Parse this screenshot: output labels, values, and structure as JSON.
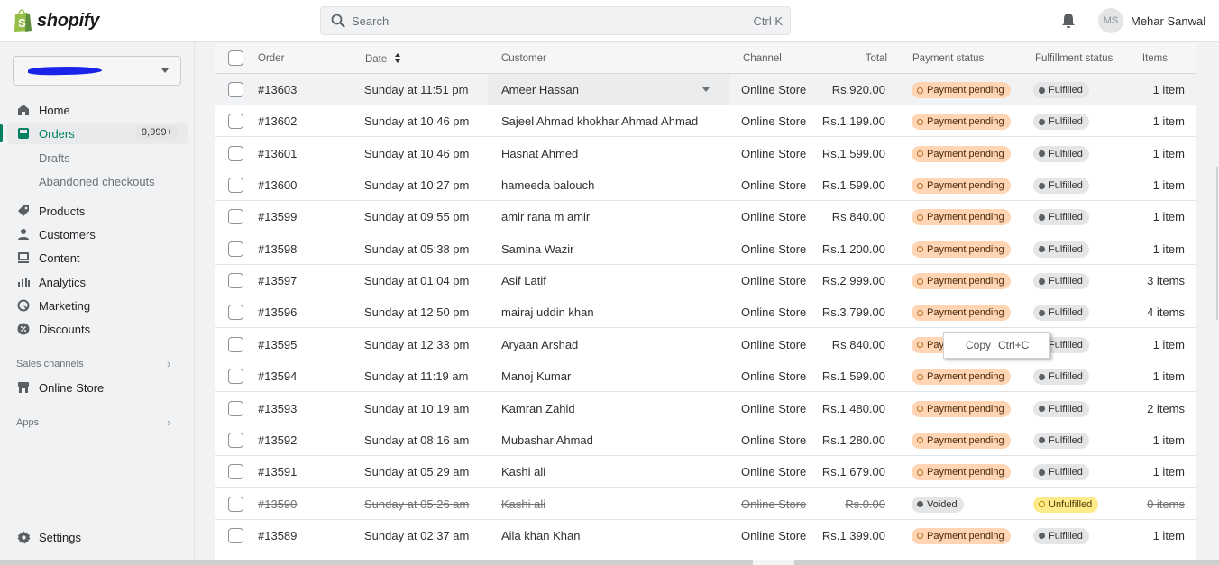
{
  "app": {
    "brand": "shopify",
    "search_placeholder": "Search",
    "search_shortcut": "Ctrl K",
    "user_initials": "MS",
    "user_name": "Mehar Sanwal"
  },
  "sidebar": {
    "store_name": "(redacted)",
    "items": [
      {
        "label": "Home",
        "icon": "home-icon"
      },
      {
        "label": "Orders",
        "icon": "orders-icon",
        "badge": "9,999+",
        "active": true
      },
      {
        "label": "Products",
        "icon": "tag-icon"
      },
      {
        "label": "Customers",
        "icon": "person-icon"
      },
      {
        "label": "Content",
        "icon": "content-icon"
      },
      {
        "label": "Analytics",
        "icon": "analytics-icon"
      },
      {
        "label": "Marketing",
        "icon": "marketing-icon"
      },
      {
        "label": "Discounts",
        "icon": "discount-icon"
      }
    ],
    "order_subitems": [
      "Drafts",
      "Abandoned checkouts"
    ],
    "sales_channels_label": "Sales channels",
    "online_store_label": "Online Store",
    "apps_label": "Apps",
    "settings_label": "Settings",
    "accent_color": "#008060"
  },
  "table": {
    "headers": {
      "order": "Order",
      "date": "Date",
      "customer": "Customer",
      "channel": "Channel",
      "total": "Total",
      "payment": "Payment status",
      "fulfillment": "Fulfillment status",
      "items": "Items"
    },
    "rows": [
      {
        "order": "#13603",
        "date": "Sunday at 11:51 pm",
        "customer": "Ameer Hassan",
        "channel": "Online Store",
        "total": "Rs.920.00",
        "payment": "Payment pending",
        "fulfillment": "Fulfilled",
        "items": "1 item"
      },
      {
        "order": "#13602",
        "date": "Sunday at 10:46 pm",
        "customer": "Sajeel Ahmad khokhar Ahmad Ahmad",
        "channel": "Online Store",
        "total": "Rs.1,199.00",
        "payment": "Payment pending",
        "fulfillment": "Fulfilled",
        "items": "1 item"
      },
      {
        "order": "#13601",
        "date": "Sunday at 10:46 pm",
        "customer": "Hasnat Ahmed",
        "channel": "Online Store",
        "total": "Rs.1,599.00",
        "payment": "Payment pending",
        "fulfillment": "Fulfilled",
        "items": "1 item"
      },
      {
        "order": "#13600",
        "date": "Sunday at 10:27 pm",
        "customer": "hameeda balouch",
        "channel": "Online Store",
        "total": "Rs.1,599.00",
        "payment": "Payment pending",
        "fulfillment": "Fulfilled",
        "items": "1 item"
      },
      {
        "order": "#13599",
        "date": "Sunday at 09:55 pm",
        "customer": "amir rana m amir",
        "channel": "Online Store",
        "total": "Rs.840.00",
        "payment": "Payment pending",
        "fulfillment": "Fulfilled",
        "items": "1 item"
      },
      {
        "order": "#13598",
        "date": "Sunday at 05:38 pm",
        "customer": "Samina Wazir",
        "channel": "Online Store",
        "total": "Rs.1,200.00",
        "payment": "Payment pending",
        "fulfillment": "Fulfilled",
        "items": "1 item"
      },
      {
        "order": "#13597",
        "date": "Sunday at 01:04 pm",
        "customer": "Asif Latif",
        "channel": "Online Store",
        "total": "Rs.2,999.00",
        "payment": "Payment pending",
        "fulfillment": "Fulfilled",
        "items": "3 items"
      },
      {
        "order": "#13596",
        "date": "Sunday at 12:50 pm",
        "customer": "mairaj uddin khan",
        "channel": "Online Store",
        "total": "Rs.3,799.00",
        "payment": "Payment pending",
        "fulfillment": "Fulfilled",
        "items": "4 items"
      },
      {
        "order": "#13595",
        "date": "Sunday at 12:33 pm",
        "customer": "Aryaan Arshad",
        "channel": "Online Store",
        "total": "Rs.840.00",
        "payment": "Payment pending",
        "fulfillment": "Fulfilled",
        "items": "1 item"
      },
      {
        "order": "#13594",
        "date": "Sunday at 11:19 am",
        "customer": "Manoj Kumar",
        "channel": "Online Store",
        "total": "Rs.1,599.00",
        "payment": "Payment pending",
        "fulfillment": "Fulfilled",
        "items": "1 item"
      },
      {
        "order": "#13593",
        "date": "Sunday at 10:19 am",
        "customer": "Kamran Zahid",
        "channel": "Online Store",
        "total": "Rs.1,480.00",
        "payment": "Payment pending",
        "fulfillment": "Fulfilled",
        "items": "2 items"
      },
      {
        "order": "#13592",
        "date": "Sunday at 08:16 am",
        "customer": "Mubashar Ahmad",
        "channel": "Online Store",
        "total": "Rs.1,280.00",
        "payment": "Payment pending",
        "fulfillment": "Fulfilled",
        "items": "1 item"
      },
      {
        "order": "#13591",
        "date": "Sunday at 05:29 am",
        "customer": "Kashi ali",
        "channel": "Online Store",
        "total": "Rs.1,679.00",
        "payment": "Payment pending",
        "fulfillment": "Fulfilled",
        "items": "1 item"
      },
      {
        "order": "#13590",
        "date": "Sunday at 05:26 am",
        "customer": "Kashi ali",
        "channel": "Online Store",
        "total": "Rs.0.00",
        "payment": "Voided",
        "fulfillment": "Unfulfilled",
        "items": "0 items",
        "voided": true
      },
      {
        "order": "#13589",
        "date": "Sunday at 02:37 am",
        "customer": "Aila khan Khan",
        "channel": "Online Store",
        "total": "Rs.1,399.00",
        "payment": "Payment pending",
        "fulfillment": "Fulfilled",
        "items": "1 item"
      }
    ]
  },
  "context_menu": {
    "label": "Copy",
    "shortcut": "Ctrl+C"
  },
  "colors": {
    "pending_bg": "#ffd5b3",
    "fulfilled_bg": "#e4e5e7",
    "unfulfilled_bg": "#ffea8a",
    "brand_green": "#95bf47"
  }
}
